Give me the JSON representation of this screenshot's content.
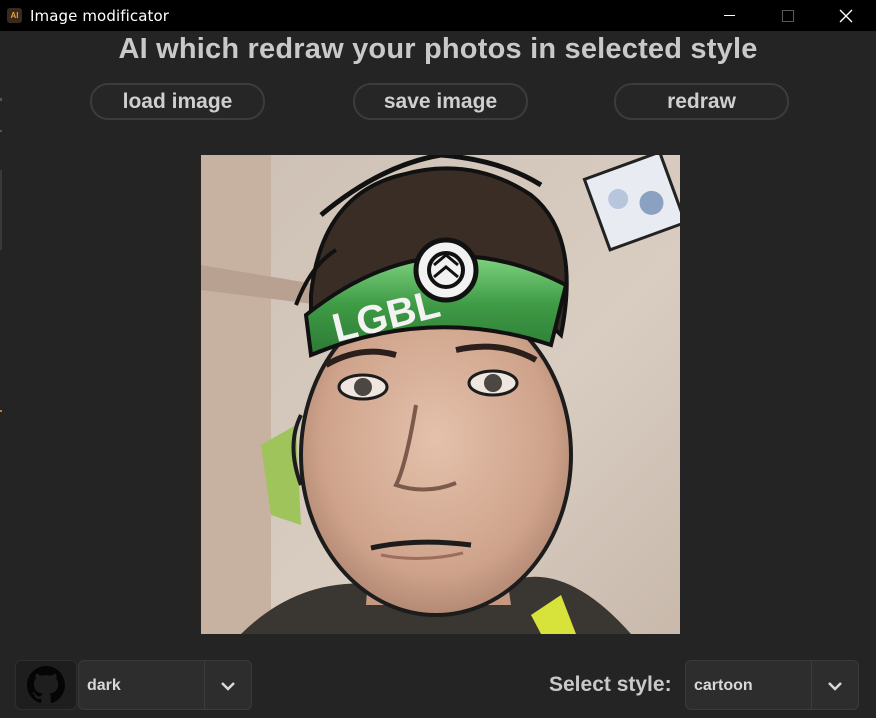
{
  "window": {
    "title": "Image modificator",
    "icon": "app-icon"
  },
  "header": {
    "title": "AI which redraw your photos in selected style"
  },
  "actions": {
    "load_label": "load image",
    "save_label": "save image",
    "redraw_label": "redraw"
  },
  "theme_select": {
    "value": "dark"
  },
  "style_select": {
    "label": "Select style:",
    "value": "cartoon"
  },
  "colors": {
    "background": "#242424",
    "titlebar": "#000000",
    "text": "#c9c9c9",
    "button_border": "#3c3c3c",
    "headband": "#3e9a45"
  },
  "icons": {
    "github": "github-icon",
    "dropdown": "chevron-down-icon",
    "minimize": "minimize-icon",
    "maximize": "maximize-icon",
    "close": "close-icon"
  }
}
